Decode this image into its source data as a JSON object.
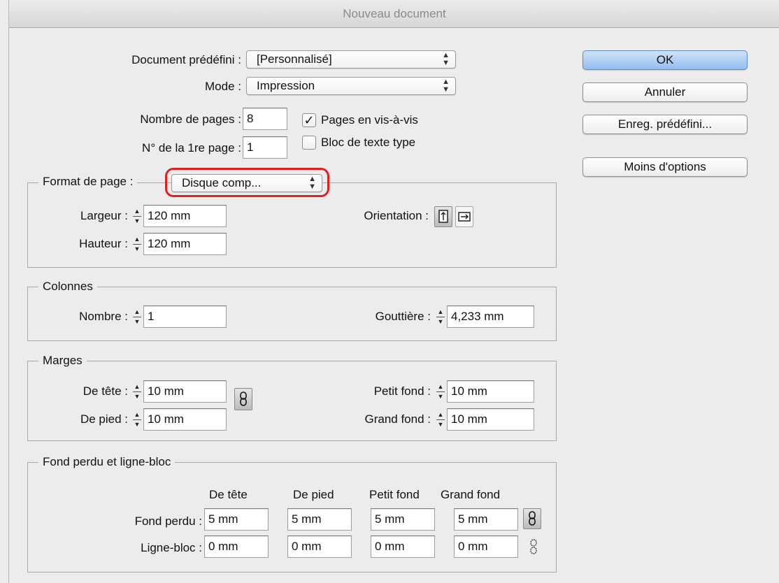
{
  "window": {
    "title": "Nouveau document"
  },
  "top": {
    "preset_label": "Document prédéfini :",
    "preset_value": "[Personnalisé]",
    "mode_label": "Mode :",
    "mode_value": "Impression",
    "pages_label": "Nombre de pages :",
    "pages_value": "8",
    "first_page_label": "N° de la 1re page :",
    "first_page_value": "1",
    "facing_pages_label": "Pages en vis-à-vis",
    "facing_pages_checked": true,
    "master_text_label": "Bloc de texte type",
    "master_text_checked": false
  },
  "buttons": {
    "ok": "OK",
    "cancel": "Annuler",
    "save_preset": "Enreg. prédéfini...",
    "fewer_options": "Moins d'options"
  },
  "page_format": {
    "label": "Format de page :",
    "value": "Disque comp...",
    "width_label": "Largeur :",
    "width_value": "120 mm",
    "height_label": "Hauteur :",
    "height_value": "120 mm",
    "orientation_label": "Orientation :"
  },
  "columns": {
    "title": "Colonnes",
    "number_label": "Nombre :",
    "number_value": "1",
    "gutter_label": "Gouttière :",
    "gutter_value": "4,233 mm"
  },
  "margins": {
    "title": "Marges",
    "top_label": "De tête :",
    "top_value": "10 mm",
    "bottom_label": "De pied :",
    "bottom_value": "10 mm",
    "inside_label": "Petit fond :",
    "inside_value": "10 mm",
    "outside_label": "Grand fond :",
    "outside_value": "10 mm"
  },
  "bleed": {
    "title": "Fond perdu et ligne-bloc",
    "headers": [
      "De tête",
      "De pied",
      "Petit fond",
      "Grand fond"
    ],
    "bleed_label": "Fond perdu :",
    "bleed_values": [
      "5 mm",
      "5 mm",
      "5 mm",
      "5 mm"
    ],
    "slug_label": "Ligne-bloc :",
    "slug_values": [
      "0 mm",
      "0 mm",
      "0 mm",
      "0 mm"
    ]
  }
}
